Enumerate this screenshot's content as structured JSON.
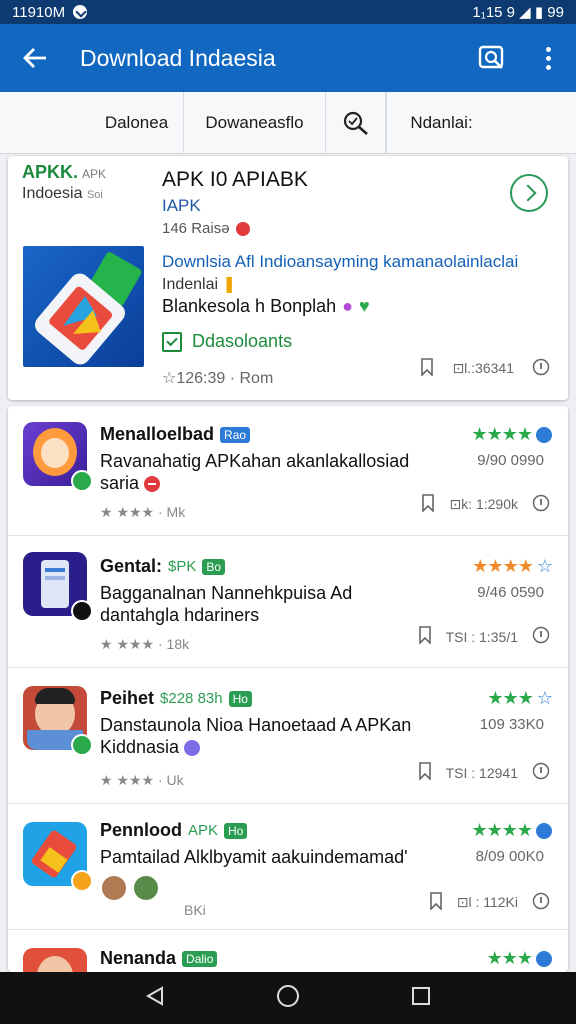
{
  "status": {
    "time": "11910M",
    "right": "1₁15 9 ◢ ▮ 99"
  },
  "appbar": {
    "title": "Download Indaesia"
  },
  "tabs": [
    "Dalonea",
    "Dowaneasflo",
    "Ndanlai:"
  ],
  "featured": {
    "logo_top": "APKK.",
    "logo_top_small": "APK",
    "logo_sub": "Indoesia",
    "logo_sub_small": "Soi",
    "title": "APK I0 APIABK",
    "sub": "IAPK",
    "rating": "146 Raisə",
    "link": "Downlsia Afl Indioansayming kamanaolainlaclai",
    "link2": "Indenlai",
    "desc": "Blankesola h Bonplah",
    "check": "Ddasoloants",
    "stat": "☆126:39 · Rom",
    "action": "⊡l.:36341"
  },
  "rows": [
    {
      "name": "Menalloelbad",
      "tag": "Rao",
      "desc": "Ravanahatig APKahan akanlakallosiad saria",
      "meta": "★ ★★★ · Mk",
      "stars": "★★★★",
      "when": "9/90 0990",
      "action": "⊡k: 1:290k"
    },
    {
      "name": "Gental:",
      "price": "$PK",
      "tag": "Bo",
      "desc": "Bagganalnan Nannehkpuisa Ad dantahgla hdariners",
      "meta": "★ ★★★ · 18k",
      "stars": "★★★★",
      "when": "9/46 0590",
      "action": "TSI : 1:35/1"
    },
    {
      "name": "Peihet",
      "price": "$228 83h",
      "tag": "Ho",
      "desc": "Danstaunola Nioa Hanoetaad A APKan Kiddnasia",
      "meta": "★ ★★★ · Uk",
      "stars": "★★★",
      "when": "109 33K0",
      "action": "TSI : 12941"
    },
    {
      "name": "Pennlood",
      "price": "APK",
      "tag": "Ho",
      "desc": "Pamtailad Alklbyamit aakuindemamad'",
      "meta": "BKi",
      "stars": "★★★★",
      "when": "8/09 00K0",
      "action": "⊡l : 112Ki"
    },
    {
      "name": "Nenanda",
      "tag": "Dalio",
      "desc": "",
      "meta": "",
      "stars": "★★★",
      "when": "",
      "action": ""
    }
  ],
  "colors": {
    "primary": "#1268c1",
    "status": "#0d3a70",
    "green": "#2a9d52",
    "star_orange": "#f0892a"
  }
}
